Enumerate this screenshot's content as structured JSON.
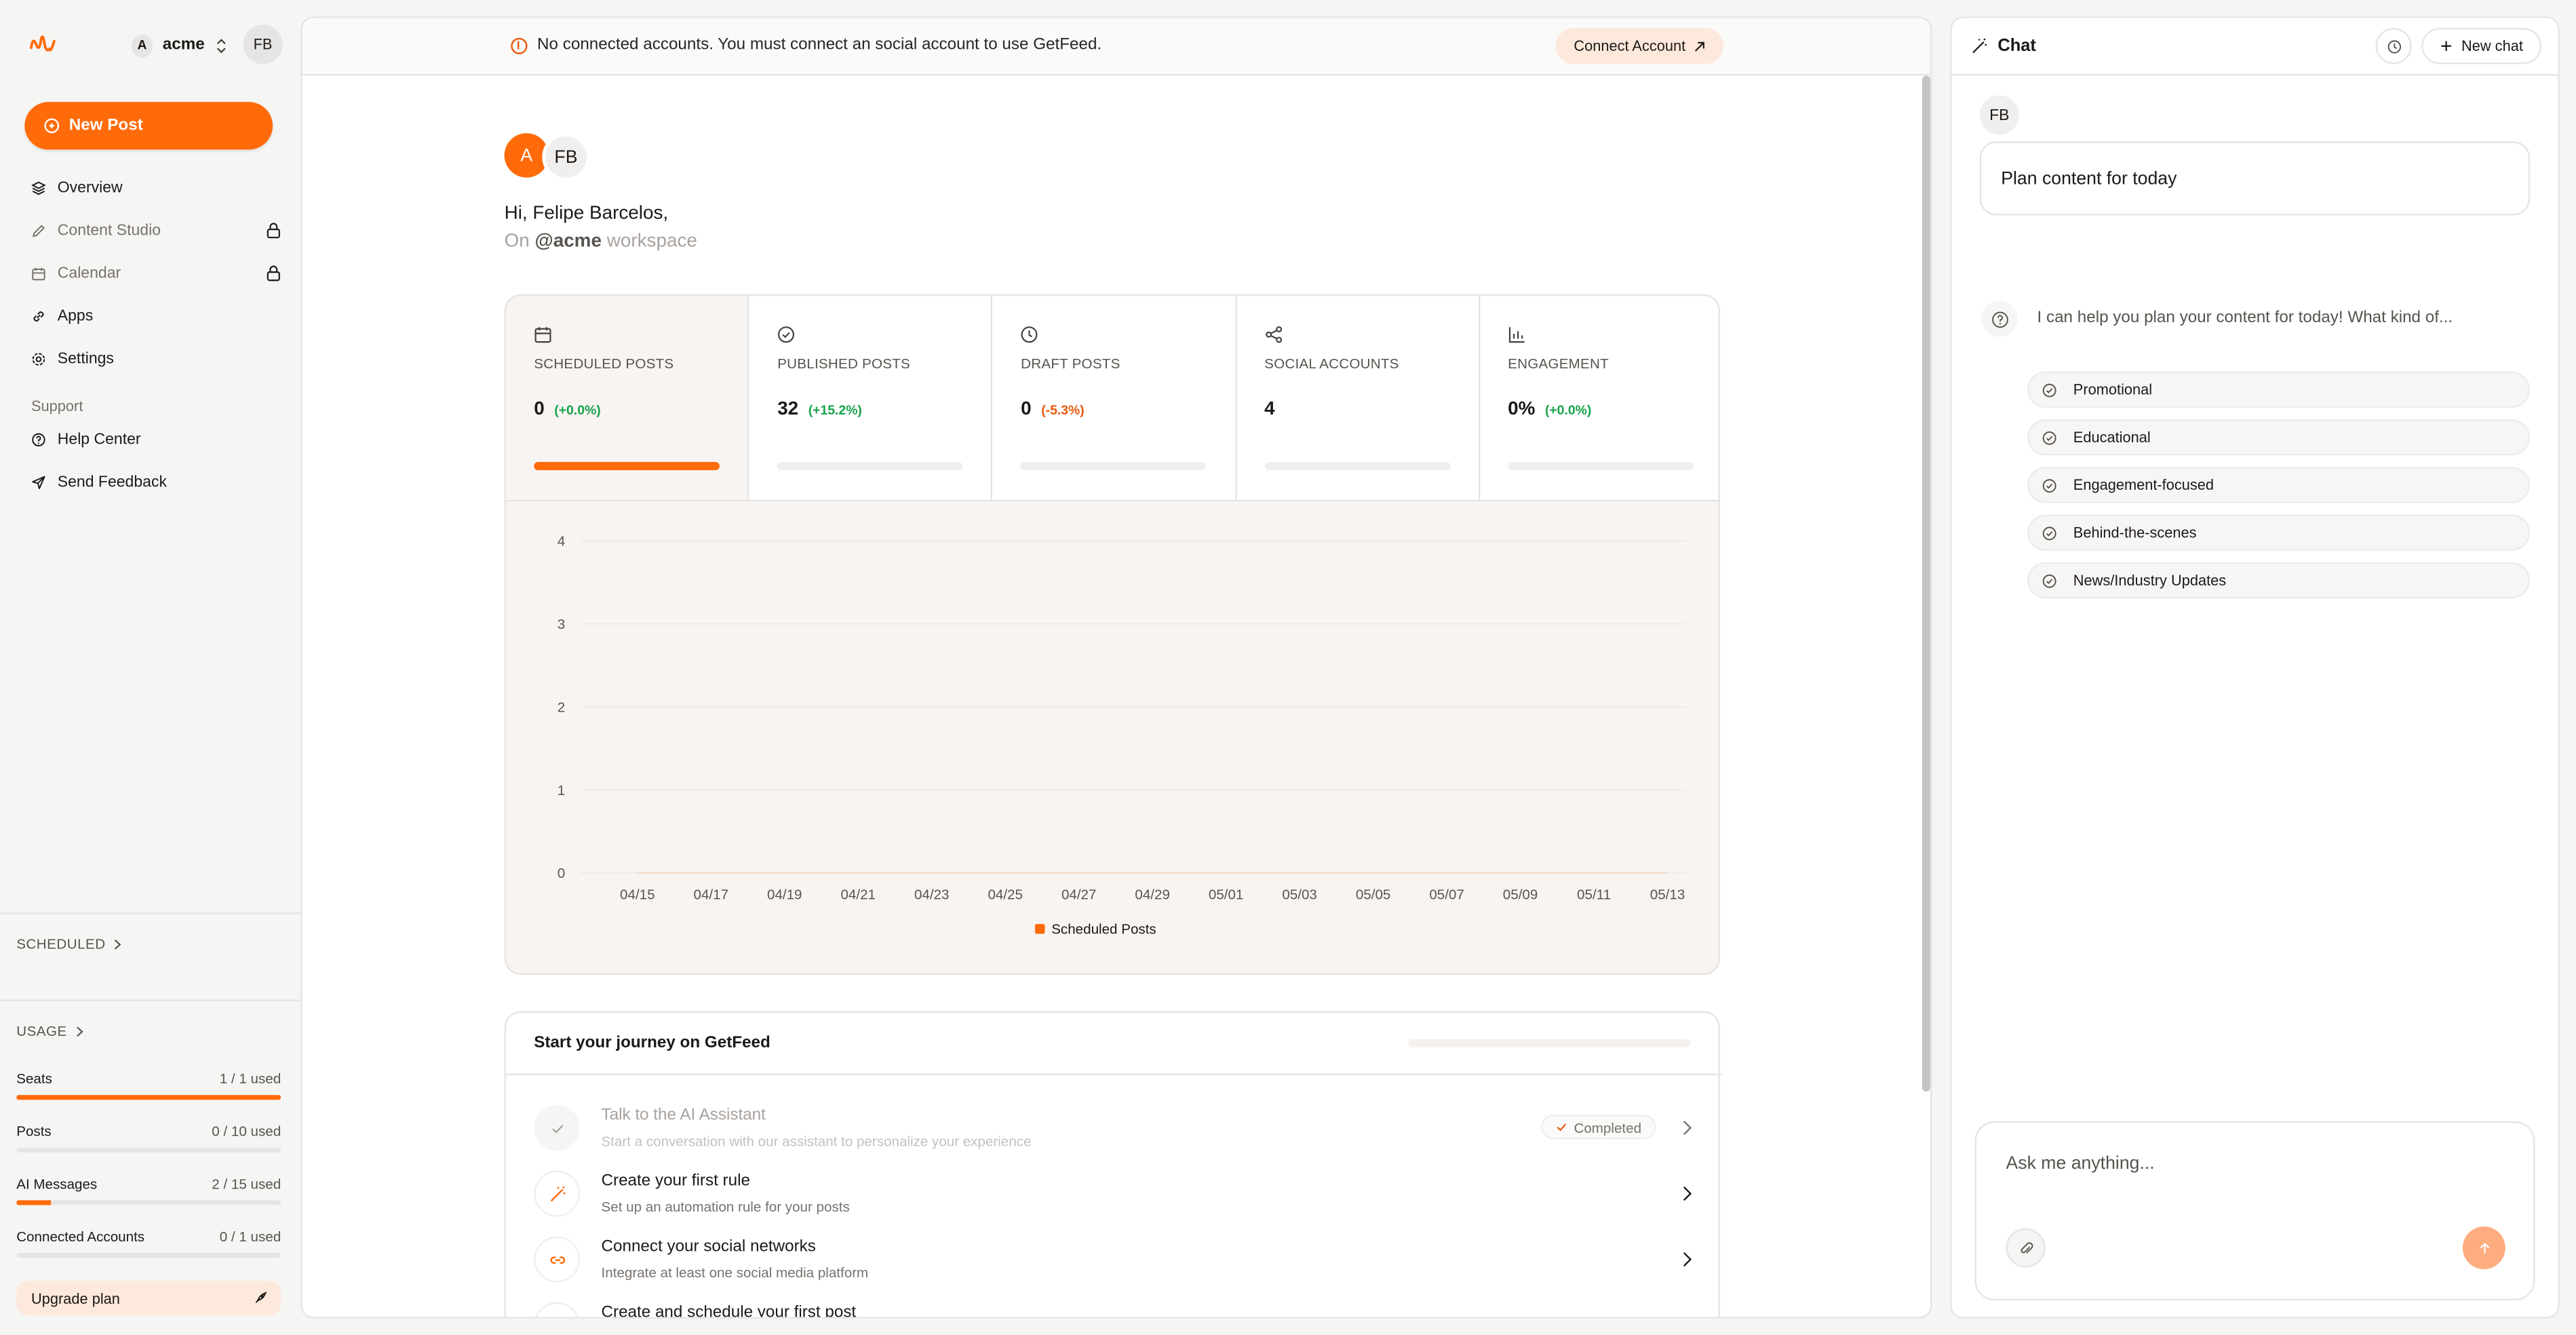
{
  "sidebar": {
    "workspace": {
      "badge": "A",
      "name": "acme"
    },
    "user_initials": "FB",
    "new_post_label": "New Post",
    "nav": [
      {
        "label": "Overview",
        "icon": "layers-icon",
        "locked": false
      },
      {
        "label": "Content Studio",
        "icon": "pen-icon",
        "locked": true
      },
      {
        "label": "Calendar",
        "icon": "calendar-icon",
        "locked": true
      },
      {
        "label": "Apps",
        "icon": "link-icon",
        "locked": false
      },
      {
        "label": "Settings",
        "icon": "gear-icon",
        "locked": false
      }
    ],
    "support_label": "Support",
    "support_nav": [
      {
        "label": "Help Center",
        "icon": "help-circle-icon"
      },
      {
        "label": "Send Feedback",
        "icon": "send-icon"
      }
    ],
    "scheduled_label": "SCHEDULED",
    "usage_label": "USAGE",
    "usage": [
      {
        "label": "Seats",
        "value": "1 / 1 used",
        "fraction": 1.0
      },
      {
        "label": "Posts",
        "value": "0 / 10 used",
        "fraction": 0.0
      },
      {
        "label": "AI Messages",
        "value": "2 / 15 used",
        "fraction": 0.133
      },
      {
        "label": "Connected Accounts",
        "value": "0 / 1 used",
        "fraction": 0.0
      }
    ],
    "upgrade_label": "Upgrade plan"
  },
  "banner": {
    "message": "No connected accounts. You must connect an social account to use GetFeed.",
    "button_label": "Connect Account"
  },
  "greeting": {
    "avatar_a": "A",
    "avatar_fb": "FB",
    "hello": "Hi, Felipe Barcelos,",
    "on": "On",
    "workspace": "@acme",
    "suffix": "workspace"
  },
  "stats": [
    {
      "label": "SCHEDULED POSTS",
      "value": "0",
      "delta": "(+0.0%)",
      "trend": "pos",
      "icon": "calendar-icon",
      "active": true
    },
    {
      "label": "PUBLISHED POSTS",
      "value": "32",
      "delta": "(+15.2%)",
      "trend": "pos",
      "icon": "check-circle-icon",
      "active": false
    },
    {
      "label": "DRAFT POSTS",
      "value": "0",
      "delta": "(-5.3%)",
      "trend": "neg",
      "icon": "clock-icon",
      "active": false
    },
    {
      "label": "SOCIAL ACCOUNTS",
      "value": "4",
      "delta": "",
      "trend": "",
      "icon": "share-icon",
      "active": false
    },
    {
      "label": "ENGAGEMENT",
      "value": "0%",
      "delta": "(+0.0%)",
      "trend": "pos",
      "icon": "bar-chart-icon",
      "active": false
    }
  ],
  "chart_data": {
    "type": "line",
    "x": [
      "04/15",
      "04/17",
      "04/19",
      "04/21",
      "04/23",
      "04/25",
      "04/27",
      "04/29",
      "05/01",
      "05/03",
      "05/05",
      "05/07",
      "05/09",
      "05/11",
      "05/13"
    ],
    "series": [
      {
        "name": "Scheduled Posts",
        "values": [
          0,
          0,
          0,
          0,
          0,
          0,
          0,
          0,
          0,
          0,
          0,
          0,
          0,
          0,
          0
        ],
        "color": "#ff6b0a"
      }
    ],
    "yticks": [
      0,
      1,
      2,
      3,
      4
    ],
    "ylim": [
      0,
      4
    ],
    "grid": true,
    "legend": "bottom-center"
  },
  "journey": {
    "title": "Start your journey on GetFeed",
    "items": [
      {
        "name": "Talk to the AI Assistant",
        "desc": "Start a conversation with our assistant to personalize your experience",
        "status": "Completed",
        "icon": "check-icon"
      },
      {
        "name": "Create your first rule",
        "desc": "Set up an automation rule for your posts",
        "status": "",
        "icon": "magic-wand-icon"
      },
      {
        "name": "Connect your social networks",
        "desc": "Integrate at least one social media platform",
        "status": "",
        "icon": "link-icon"
      },
      {
        "name": "Create and schedule your first post",
        "desc": "",
        "status": "",
        "icon": "calendar-icon"
      }
    ]
  },
  "chat": {
    "title": "Chat",
    "new_chat_label": "New chat",
    "user_initials": "FB",
    "user_message": "Plan content for today",
    "ai_message": "I can help you plan your content for today! What kind of...",
    "suggestions": [
      "Promotional",
      "Educational",
      "Engagement-focused",
      "Behind-the-scenes",
      "News/Industry Updates"
    ],
    "input_placeholder": "Ask me anything..."
  },
  "colors": {
    "accent": "#ff6b0a",
    "positive": "#16a34a",
    "negative": "#ea580c"
  }
}
